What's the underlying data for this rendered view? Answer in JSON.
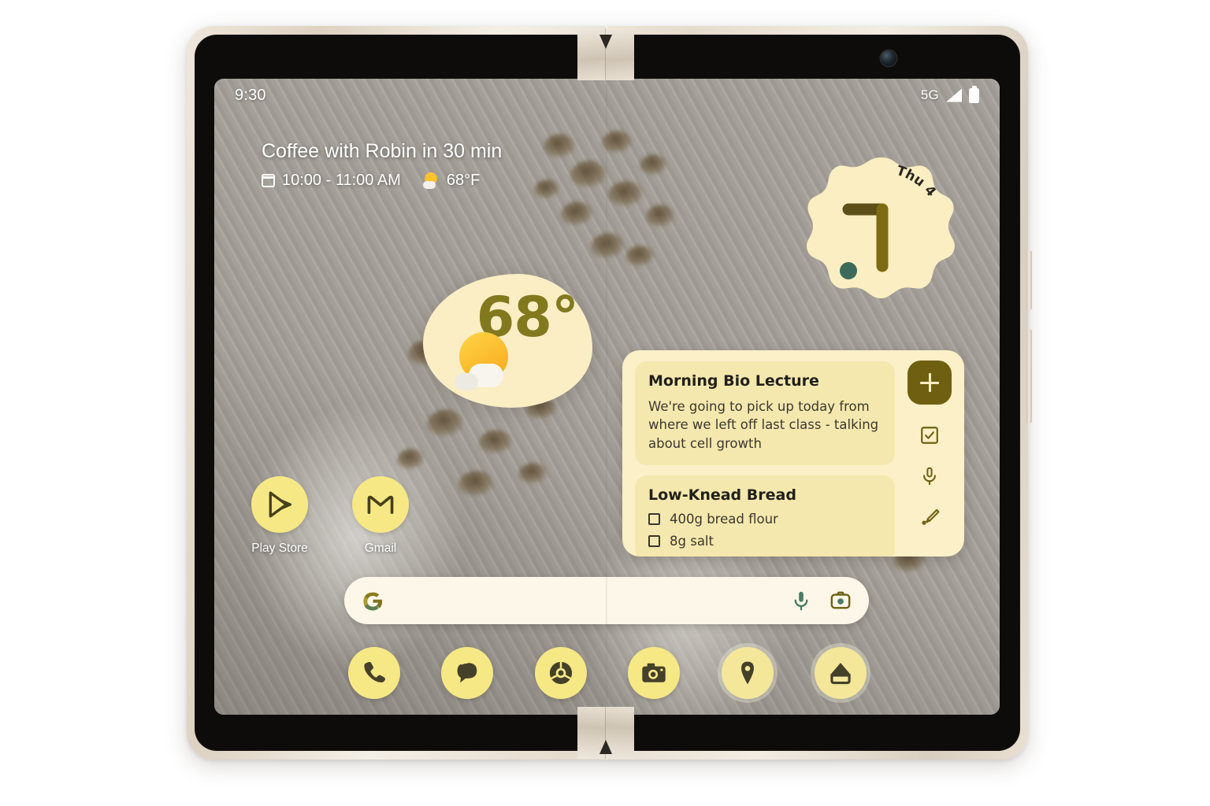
{
  "device": {
    "name": "Google Pixel Fold",
    "frame_color": "#e6dcce",
    "bezel_color": "#0d0c0b"
  },
  "status_bar": {
    "time": "9:30",
    "network": "5G",
    "signal_icon": "signal-bars-icon",
    "battery_icon": "battery-full-icon"
  },
  "at_a_glance": {
    "title": "Coffee with Robin in 30 min",
    "calendar_icon": "calendar-icon",
    "time_range": "10:00 - 11:00 AM",
    "weather_icon": "sun-behind-cloud-icon",
    "temperature": "68°F"
  },
  "clock_widget": {
    "day_label": "Thu 4",
    "shape": "scalloped-blob",
    "background": "#faeec2",
    "hour_hand_color": "#5c4f18",
    "minute_hand_color": "#7d6a12",
    "dot_color": "#3c6b5c"
  },
  "weather_widget": {
    "temperature": "68°",
    "icon": "sun-behind-cloud-icon",
    "background": "#fbeec4",
    "text_color": "#82791f"
  },
  "notes_widget": {
    "background": "#fbf0c8",
    "card_background": "#f5e8ae",
    "notes": [
      {
        "title": "Morning Bio Lecture",
        "body": "We're going to pick up today from where we left off last class - talking about cell growth",
        "items": []
      },
      {
        "title": "Low-Knead Bread",
        "body": "",
        "items": [
          "400g bread flour",
          "8g salt"
        ]
      }
    ],
    "actions": [
      {
        "name": "add-note-button",
        "label": "+"
      },
      {
        "name": "new-list-button",
        "label": "checkbox"
      },
      {
        "name": "voice-note-button",
        "label": "microphone"
      },
      {
        "name": "drawing-note-button",
        "label": "brush"
      }
    ]
  },
  "app_icons": [
    {
      "label": "Play Store",
      "icon": "play-store-icon"
    },
    {
      "label": "Gmail",
      "icon": "gmail-icon"
    }
  ],
  "search_bar": {
    "logo": "google-g-icon",
    "placeholder": "",
    "value": "",
    "mic_icon": "microphone-icon",
    "lens_icon": "google-lens-icon",
    "background": "#fdf7e9"
  },
  "dock": {
    "background": "transparent",
    "icon_background": "#f7e886",
    "items": [
      {
        "name": "dock-phone",
        "label": "Phone",
        "icon": "phone-icon"
      },
      {
        "name": "dock-messages",
        "label": "Messages",
        "icon": "message-bubble-icon"
      },
      {
        "name": "dock-chrome",
        "label": "Chrome",
        "icon": "chrome-icon"
      },
      {
        "name": "dock-camera",
        "label": "Camera",
        "icon": "camera-icon"
      },
      {
        "name": "dock-maps",
        "label": "Maps",
        "icon": "map-pin-icon"
      },
      {
        "name": "dock-home",
        "label": "Home",
        "icon": "home-icon"
      }
    ]
  },
  "theme": {
    "accent_yellow": "#f7e886",
    "accent_olive": "#6e6010",
    "cream": "#faeec2",
    "teal": "#3c6b5c"
  }
}
